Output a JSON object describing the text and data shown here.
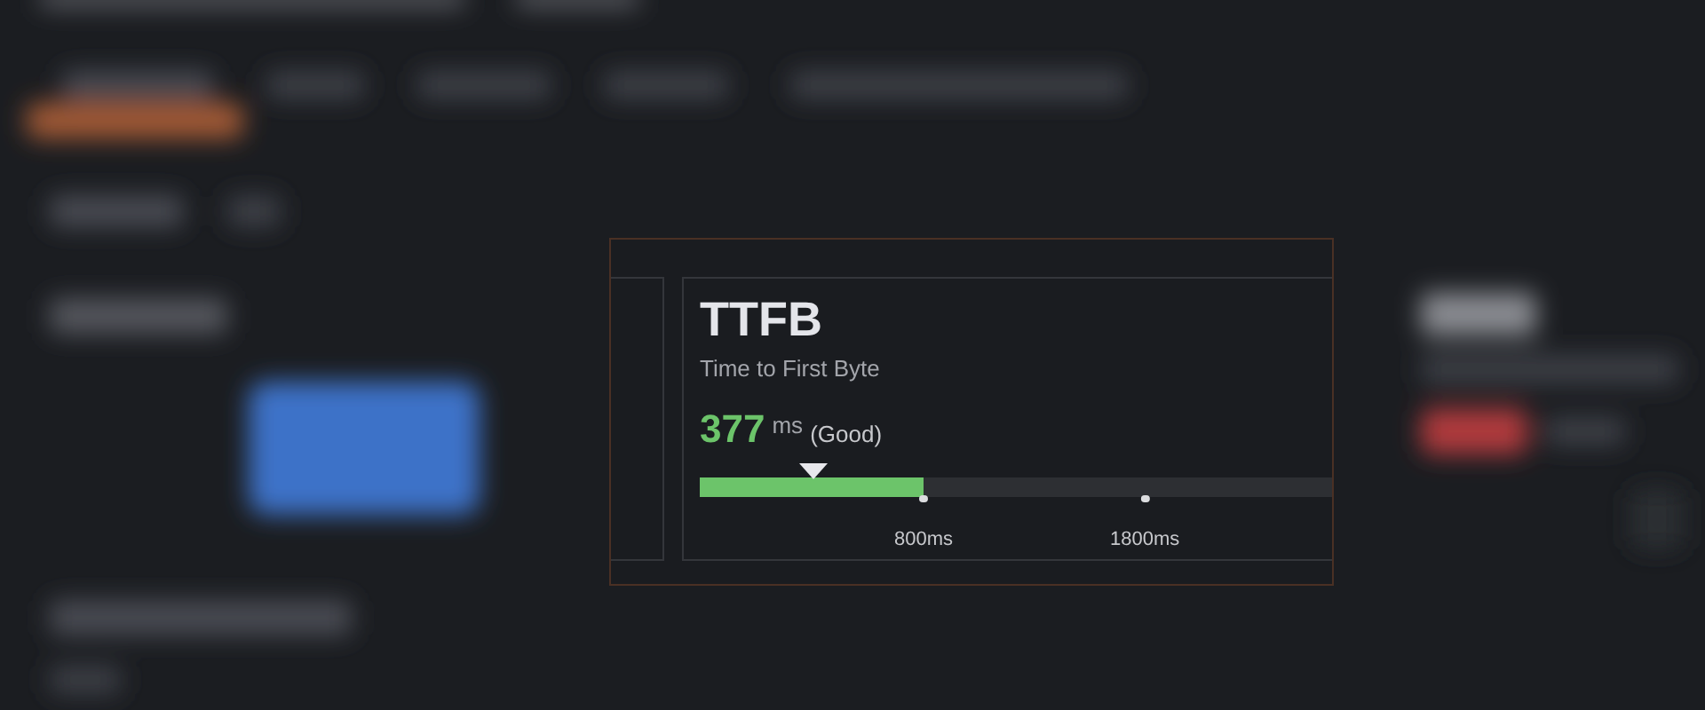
{
  "metric": {
    "title": "TTFB",
    "subtitle": "Time to First Byte",
    "value": "377",
    "unit": "ms",
    "rating_label": "(Good)",
    "good_zone": {
      "level": 0.352
    },
    "marker": {
      "level": 0.18
    },
    "ticks": [
      {
        "label": "800ms"
      },
      {
        "label": "1800ms"
      }
    ]
  }
}
